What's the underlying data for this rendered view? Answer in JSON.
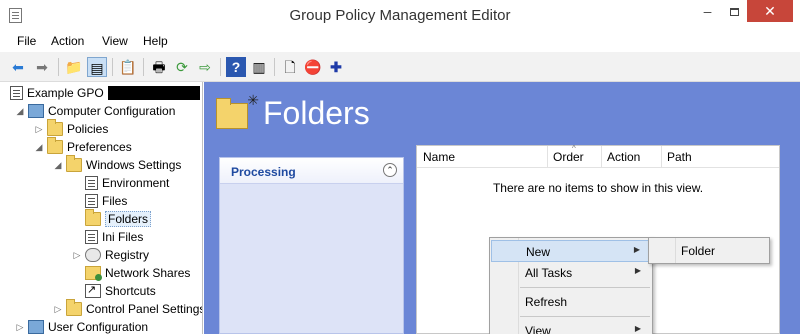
{
  "window": {
    "title": "Group Policy Management Editor",
    "minimize_glyph": "–",
    "close_glyph": "✕"
  },
  "menubar": [
    "File",
    "Action",
    "View",
    "Help"
  ],
  "toolbar": {
    "icons": [
      "back-icon",
      "forward-icon",
      "up-folder-icon",
      "show-hide-tree-icon",
      "properties-icon",
      "print-icon",
      "refresh-icon",
      "export-icon",
      "help-icon",
      "show-action-pane-icon",
      "new-icon",
      "stop-icon",
      "add-icon"
    ]
  },
  "tree": {
    "root_label": "Example GPO",
    "computer_config": "Computer Configuration",
    "policies": "Policies",
    "preferences": "Preferences",
    "windows_settings": "Windows Settings",
    "environment": "Environment",
    "files": "Files",
    "folders": "Folders",
    "ini_files": "Ini Files",
    "registry": "Registry",
    "network_shares": "Network Shares",
    "shortcuts": "Shortcuts",
    "control_panel": "Control Panel Settings",
    "user_config": "User Configuration"
  },
  "content": {
    "title": "Folders",
    "processing_label": "Processing",
    "columns": [
      "Name",
      "Order",
      "Action",
      "Path"
    ],
    "empty_message": "There are no items to show in this view."
  },
  "context_menu": {
    "new": "New",
    "all_tasks": "All Tasks",
    "refresh": "Refresh",
    "view": "View",
    "submenu_folder": "Folder"
  },
  "colors": {
    "content_bg": "#6b86d6",
    "processing_title": "#1f4aa0",
    "close_button": "#c7463a"
  }
}
